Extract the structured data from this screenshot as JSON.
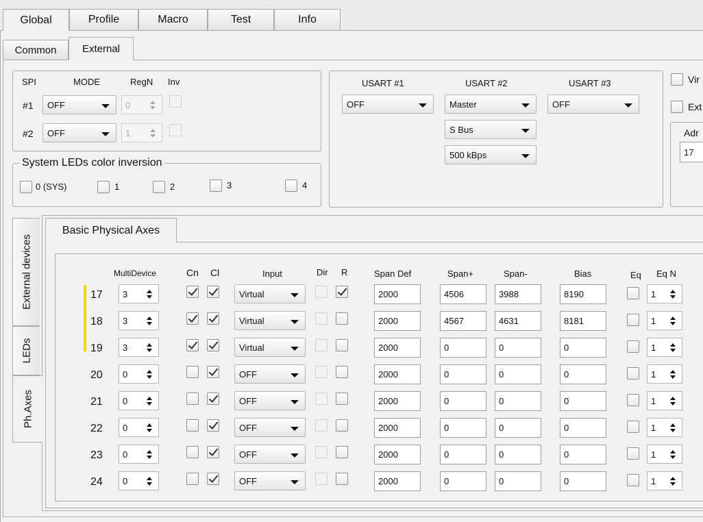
{
  "main_tabs": [
    "Global",
    "Profile",
    "Macro",
    "Test",
    "Info"
  ],
  "sub_tabs": [
    "Common",
    "External"
  ],
  "spi": {
    "headers": {
      "spi": "SPI",
      "mode": "MODE",
      "regn": "RegN",
      "inv": "Inv"
    },
    "rows": [
      {
        "label": "#1",
        "mode": "OFF",
        "regn": "0"
      },
      {
        "label": "#2",
        "mode": "OFF",
        "regn": "1"
      }
    ]
  },
  "leds_inversion": {
    "title": "System LEDs color inversion",
    "items": [
      "0 (SYS)",
      "1",
      "2",
      "3",
      "4"
    ]
  },
  "usart": {
    "headers": [
      "USART #1",
      "USART #2",
      "USART #3"
    ],
    "usart1": "OFF",
    "usart2": [
      "Master",
      "S Bus",
      "500 kBps"
    ],
    "usart3": "OFF"
  },
  "right_panel": {
    "checkbox1": "Vir",
    "checkbox2": "Ext",
    "group_title": "Adr",
    "address_value": "17"
  },
  "side_tabs": [
    "External devices",
    "LEDs",
    "Ph.Axes"
  ],
  "axes_tab": "Basic Physical Axes",
  "columns": {
    "multidevice": "MultiDevice",
    "cn": "Cn",
    "cl": "Cl",
    "input": "Input",
    "dir": "Dir",
    "r": "R",
    "span_def": "Span Def",
    "span_plus": "Span+",
    "span_minus": "Span-",
    "bias": "Bias",
    "eq": "Eq",
    "eq_n": "Eq N"
  },
  "colors": {
    "highlight_bar": "#f5d800"
  },
  "axes": [
    {
      "num": "17",
      "multidevice": "3",
      "cn": true,
      "cl": true,
      "input": "Virtual",
      "dir": false,
      "r": true,
      "span_def": "2000",
      "span_plus": "4506",
      "span_minus": "3988",
      "bias": "8190",
      "eq": false,
      "eq_n": "1",
      "highlight": true
    },
    {
      "num": "18",
      "multidevice": "3",
      "cn": true,
      "cl": true,
      "input": "Virtual",
      "dir": false,
      "r": false,
      "span_def": "2000",
      "span_plus": "4567",
      "span_minus": "4631",
      "bias": "8181",
      "eq": false,
      "eq_n": "1",
      "highlight": true
    },
    {
      "num": "19",
      "multidevice": "3",
      "cn": true,
      "cl": true,
      "input": "Virtual",
      "dir": false,
      "r": false,
      "span_def": "2000",
      "span_plus": "0",
      "span_minus": "0",
      "bias": "0",
      "eq": false,
      "eq_n": "1",
      "highlight": true
    },
    {
      "num": "20",
      "multidevice": "0",
      "cn": false,
      "cl": true,
      "input": "OFF",
      "dir": false,
      "r": false,
      "span_def": "2000",
      "span_plus": "0",
      "span_minus": "0",
      "bias": "0",
      "eq": false,
      "eq_n": "1",
      "highlight": false
    },
    {
      "num": "21",
      "multidevice": "0",
      "cn": false,
      "cl": true,
      "input": "OFF",
      "dir": false,
      "r": false,
      "span_def": "2000",
      "span_plus": "0",
      "span_minus": "0",
      "bias": "0",
      "eq": false,
      "eq_n": "1",
      "highlight": false
    },
    {
      "num": "22",
      "multidevice": "0",
      "cn": false,
      "cl": true,
      "input": "OFF",
      "dir": false,
      "r": false,
      "span_def": "2000",
      "span_plus": "0",
      "span_minus": "0",
      "bias": "0",
      "eq": false,
      "eq_n": "1",
      "highlight": false
    },
    {
      "num": "23",
      "multidevice": "0",
      "cn": false,
      "cl": true,
      "input": "OFF",
      "dir": false,
      "r": false,
      "span_def": "2000",
      "span_plus": "0",
      "span_minus": "0",
      "bias": "0",
      "eq": false,
      "eq_n": "1",
      "highlight": false
    },
    {
      "num": "24",
      "multidevice": "0",
      "cn": false,
      "cl": true,
      "input": "OFF",
      "dir": false,
      "r": false,
      "span_def": "2000",
      "span_plus": "0",
      "span_minus": "0",
      "bias": "0",
      "eq": false,
      "eq_n": "1",
      "highlight": false
    }
  ]
}
